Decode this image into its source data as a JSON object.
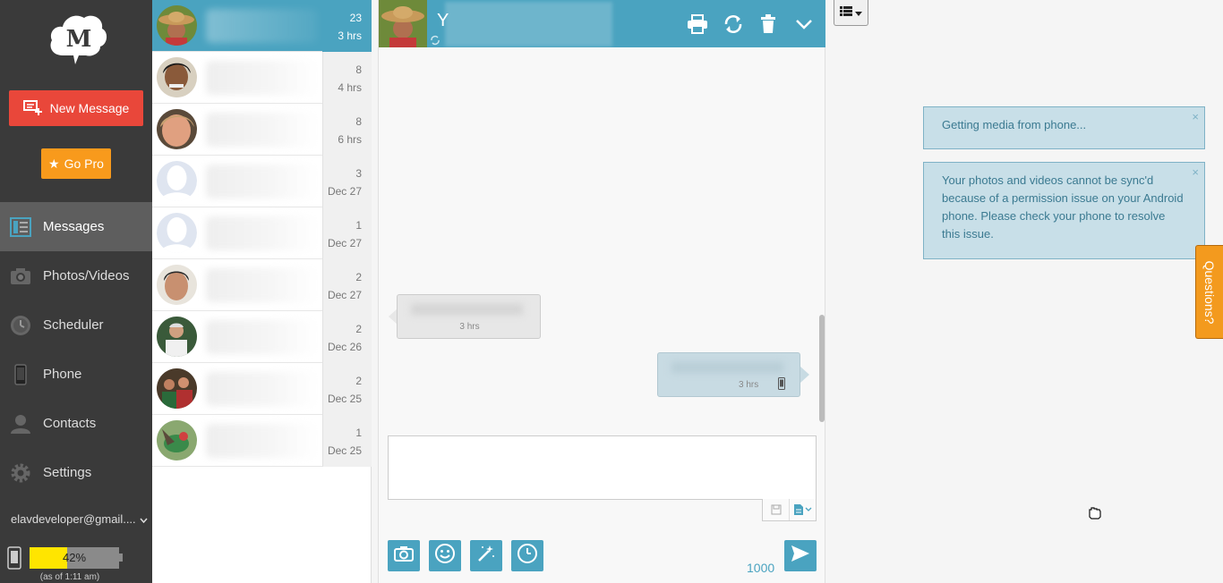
{
  "sidebar": {
    "logo_letter": "M",
    "new_message_label": "New Message",
    "go_pro_label": "Go Pro",
    "nav": [
      {
        "label": "Messages",
        "icon": "messages-icon",
        "active": true
      },
      {
        "label": "Photos/Videos",
        "icon": "camera-icon"
      },
      {
        "label": "Scheduler",
        "icon": "clock-icon"
      },
      {
        "label": "Phone",
        "icon": "phone-icon"
      },
      {
        "label": "Contacts",
        "icon": "contact-icon"
      },
      {
        "label": "Settings",
        "icon": "gear-icon"
      }
    ],
    "account": "elavdeveloper@gmail....",
    "battery": {
      "level_percent": 42,
      "label": "42%",
      "as_of": "(as of 1:11 am)"
    }
  },
  "conversations": [
    {
      "count": "23",
      "time": "3 hrs",
      "active": true
    },
    {
      "count": "8",
      "time": "4 hrs"
    },
    {
      "count": "8",
      "time": "6 hrs"
    },
    {
      "count": "3",
      "time": "Dec 27"
    },
    {
      "count": "1",
      "time": "Dec 27"
    },
    {
      "count": "2",
      "time": "Dec 27"
    },
    {
      "count": "2",
      "time": "Dec 26"
    },
    {
      "count": "2",
      "time": "Dec 25"
    },
    {
      "count": "1",
      "time": "Dec 25"
    }
  ],
  "chat": {
    "name_initial": "Y",
    "messages": [
      {
        "direction": "incoming",
        "time": "3 hrs"
      },
      {
        "direction": "outgoing",
        "time": "3 hrs"
      }
    ],
    "char_remaining": "1000"
  },
  "notices": [
    {
      "text": "Getting media from phone..."
    },
    {
      "text": "Your photos and videos cannot be sync'd because of a permission issue on your Android phone. Please check your phone to resolve this issue."
    }
  ],
  "questions_tab": "Questions?",
  "colors": {
    "accent": "#4aa3c0",
    "new_message": "#e9473a",
    "go_pro": "#f89a1c",
    "sidebar": "#3a3a3a",
    "battery_fill": "#ffe500"
  }
}
